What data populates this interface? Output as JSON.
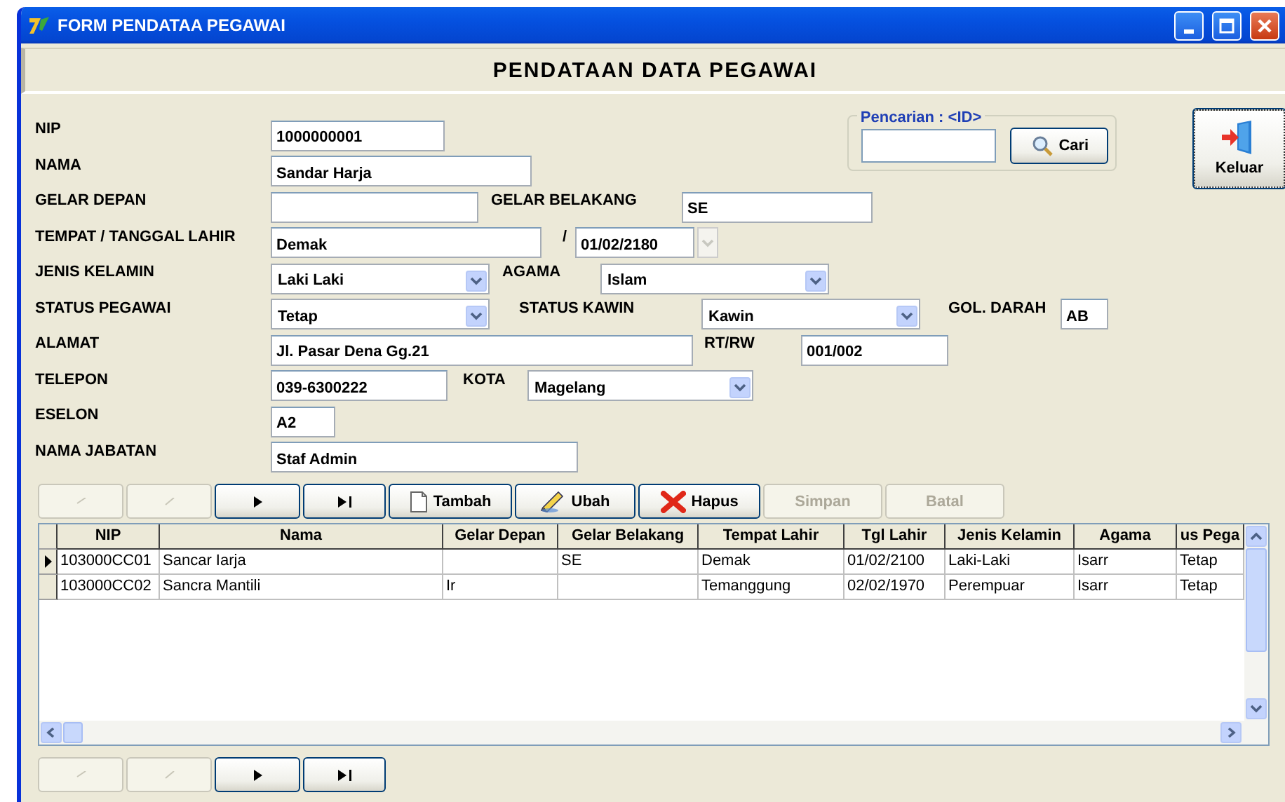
{
  "window": {
    "title": "FORM PENDATAA PEGAWAI"
  },
  "heading": "PENDATAAN DATA PEGAWAI",
  "form_rows": [
    {
      "items": [
        {
          "kind": "label",
          "text": "NIP"
        },
        {
          "kind": "text",
          "value": "1000000001"
        }
      ]
    },
    {
      "items": [
        {
          "kind": "label",
          "text": "NAMA"
        },
        {
          "kind": "text",
          "value": "Sandar Harja"
        }
      ]
    },
    {
      "items": [
        {
          "kind": "label",
          "text": "GELAR DEPAN"
        },
        {
          "kind": "text"
        },
        {
          "kind": "label",
          "text": "GELAR BELAKANG"
        },
        {
          "kind": "text",
          "value": "SE"
        }
      ]
    },
    {
      "items": [
        {
          "kind": "label",
          "text": "TEMPAT / TANGGAL LAHIR"
        },
        {
          "kind": "text",
          "value": "Demak"
        },
        {
          "kind": "label",
          "text": "/"
        },
        {
          "kind": "date",
          "value": "01/02/2180"
        }
      ]
    },
    {
      "items": [
        {
          "kind": "label",
          "text": "JENIS KELAMIN"
        },
        {
          "kind": "combo",
          "value": "Laki Laki"
        },
        {
          "kind": "label",
          "text": "AGAMA"
        },
        {
          "kind": "combo",
          "value": "Islam"
        }
      ]
    },
    {
      "items": [
        {
          "kind": "label",
          "text": "STATUS PEGAWAI"
        },
        {
          "kind": "combo",
          "value": "Tetap"
        },
        {
          "kind": "label",
          "text": "STATUS KAWIN"
        },
        {
          "kind": "combo",
          "value": "Kawin"
        },
        {
          "kind": "label",
          "text": "GOL. DARAH"
        },
        {
          "kind": "text",
          "value": "AB"
        }
      ]
    },
    {
      "items": [
        {
          "kind": "label",
          "text": "ALAMAT"
        },
        {
          "kind": "text",
          "value": "Jl. Pasar Dena Gg.21"
        },
        {
          "kind": "label",
          "text": "RT/RW"
        },
        {
          "kind": "text",
          "value": "001/002"
        }
      ]
    },
    {
      "items": [
        {
          "kind": "label",
          "text": "TELEPON"
        },
        {
          "kind": "text",
          "value": "039-6300222"
        },
        {
          "kind": "label",
          "text": "KOTA"
        },
        {
          "kind": "combo",
          "value": "Magelang"
        }
      ]
    },
    {
      "items": [
        {
          "kind": "label",
          "text": "ESELON"
        },
        {
          "kind": "text",
          "value": "A2"
        }
      ]
    },
    {
      "items": [
        {
          "kind": "label",
          "text": "NAMA JABATAN"
        },
        {
          "kind": "text",
          "value": "Staf Admin"
        }
      ]
    }
  ],
  "search": {
    "legend": "Pencarian : <ID>",
    "button": "Cari"
  },
  "exit_button": "Keluar",
  "toolbar": [
    {
      "kind": "first",
      "disabled": true
    },
    {
      "kind": "prior",
      "disabled": true
    },
    {
      "kind": "next",
      "disabled": false
    },
    {
      "kind": "last",
      "disabled": false
    },
    {
      "kind": "add",
      "label": "Tambah",
      "disabled": false
    },
    {
      "kind": "edit",
      "label": "Ubah",
      "disabled": false
    },
    {
      "kind": "delete",
      "label": "Hapus",
      "disabled": false
    },
    {
      "kind": "save",
      "label": "Simpan",
      "disabled": true
    },
    {
      "kind": "cancel",
      "label": "Batal",
      "disabled": true
    }
  ],
  "table": {
    "columns": [
      "NIP",
      "Nama",
      "Gelar Depan",
      "Gelar Belakang",
      "Tempat Lahir",
      "Tgl Lahir",
      "Jenis Kelamin",
      "Agama",
      "us Pega"
    ],
    "rows": [
      {
        "selected": true,
        "cells": [
          "103000CC01",
          "Sancar Iarja",
          null,
          "SE",
          "Demak",
          "01/02/2100",
          "Laki-Laki",
          "Isarr",
          "Tetap"
        ]
      },
      {
        "selected": false,
        "cells": [
          "103000CC02",
          "Sancra Mantili",
          "Ir",
          null,
          "Temanggung",
          "02/02/1970",
          "Perempuar",
          "Isarr",
          "Tetap"
        ]
      }
    ]
  },
  "bottom_nav": [
    {
      "kind": "first",
      "disabled": true
    },
    {
      "kind": "prior",
      "disabled": true
    },
    {
      "kind": "next",
      "disabled": false
    },
    {
      "kind": "last",
      "disabled": false
    }
  ]
}
